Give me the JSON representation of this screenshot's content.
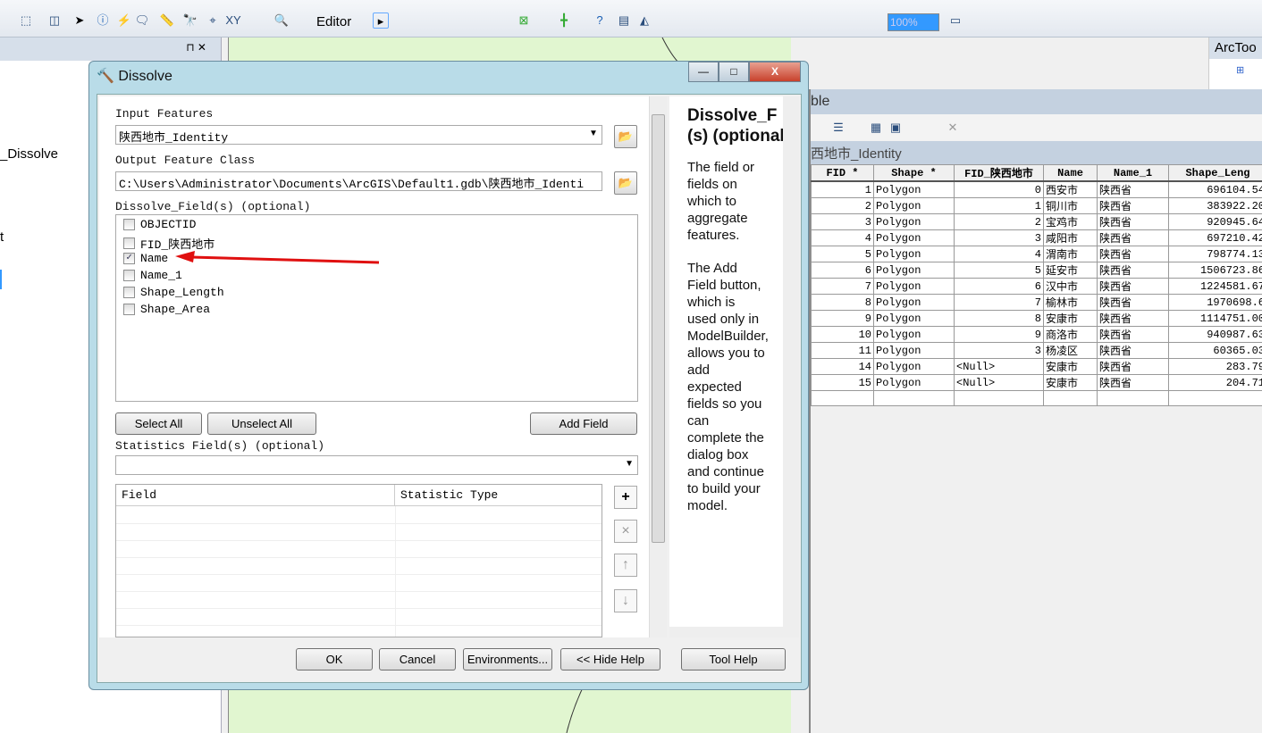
{
  "toolbar": {
    "editor_label": "Editor",
    "zoom_value": "100%"
  },
  "left_panel": {
    "item1": "_Dissolve",
    "item2": "t"
  },
  "toolbox": {
    "title": "ArcToo"
  },
  "table_window": {
    "title": "ble",
    "layer_tab": "西地市_Identity",
    "columns": [
      "FID *",
      "Shape *",
      "FID_陕西地市",
      "Name",
      "Name_1",
      "Shape_Leng"
    ],
    "rows": [
      [
        "1",
        "Polygon",
        "0",
        "西安市",
        "陕西省",
        "696104.54"
      ],
      [
        "2",
        "Polygon",
        "1",
        "铜川市",
        "陕西省",
        "383922.20"
      ],
      [
        "3",
        "Polygon",
        "2",
        "宝鸡市",
        "陕西省",
        "920945.64"
      ],
      [
        "4",
        "Polygon",
        "3",
        "咸阳市",
        "陕西省",
        "697210.42"
      ],
      [
        "5",
        "Polygon",
        "4",
        "渭南市",
        "陕西省",
        "798774.13"
      ],
      [
        "6",
        "Polygon",
        "5",
        "延安市",
        "陕西省",
        "1506723.86"
      ],
      [
        "7",
        "Polygon",
        "6",
        "汉中市",
        "陕西省",
        "1224581.67"
      ],
      [
        "8",
        "Polygon",
        "7",
        "榆林市",
        "陕西省",
        "1970698.6"
      ],
      [
        "9",
        "Polygon",
        "8",
        "安康市",
        "陕西省",
        "1114751.00"
      ],
      [
        "10",
        "Polygon",
        "9",
        "商洛市",
        "陕西省",
        "940987.63"
      ],
      [
        "11",
        "Polygon",
        "3",
        "杨凌区",
        "陕西省",
        "60365.03"
      ],
      [
        "14",
        "Polygon",
        "<Null>",
        "安康市",
        "陕西省",
        "283.79"
      ],
      [
        "15",
        "Polygon",
        "<Null>",
        "安康市",
        "陕西省",
        "204.71"
      ]
    ]
  },
  "dialog": {
    "title": "Dissolve",
    "input_label": "Input Features",
    "input_value": "陕西地市_Identity",
    "output_label": "Output Feature Class",
    "output_value": "C:\\Users\\Administrator\\Documents\\ArcGIS\\Default1.gdb\\陕西地市_Identi",
    "dissolve_label": "Dissolve_Field(s) (optional)",
    "fields": [
      {
        "name": "OBJECTID",
        "checked": false
      },
      {
        "name": "FID_陕西地市",
        "checked": false
      },
      {
        "name": "Name",
        "checked": true
      },
      {
        "name": "Name_1",
        "checked": false
      },
      {
        "name": "Shape_Length",
        "checked": false
      },
      {
        "name": "Shape_Area",
        "checked": false
      }
    ],
    "select_all": "Select All",
    "unselect_all": "Unselect All",
    "add_field": "Add Field",
    "stats_label": "Statistics Field(s) (optional)",
    "grid_headers": [
      "Field",
      "Statistic Type"
    ],
    "buttons": {
      "ok": "OK",
      "cancel": "Cancel",
      "environments": "Environments...",
      "hide_help": "<< Hide Help",
      "tool_help": "Tool Help"
    },
    "help": {
      "title": "Dissolve_F (s) (optional)",
      "p1": "The field or fields on which to aggregate features.",
      "p2": "The Add Field button, which is used only in ModelBuilder, allows you to add expected fields so you can complete the dialog box and continue to build your model."
    }
  },
  "colors": {
    "annotation_arrow": "#e01010",
    "map_bg": "#e1f6d0",
    "title_blue": "#b9dce8"
  }
}
